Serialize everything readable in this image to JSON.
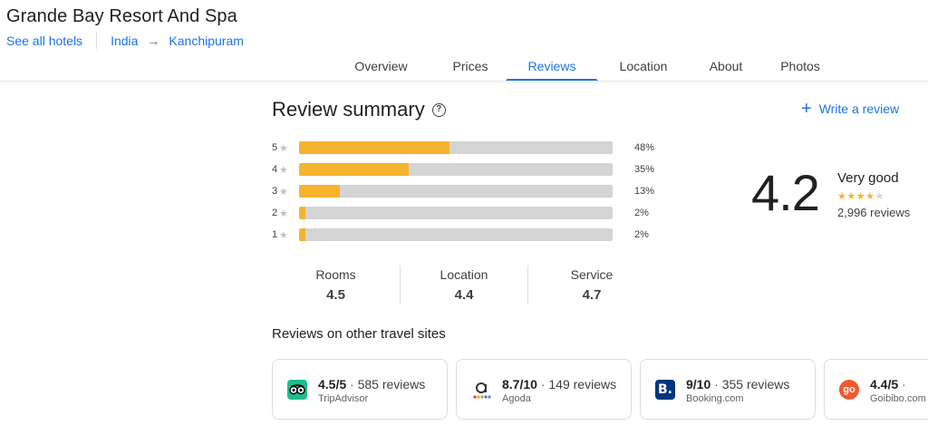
{
  "header": {
    "hotel_name": "Grande Bay Resort And Spa",
    "see_all": "See all hotels",
    "crumb_country": "India",
    "crumb_arrow": "→",
    "crumb_city": "Kanchipuram"
  },
  "tabs": [
    {
      "label": "Overview",
      "active": false
    },
    {
      "label": "Prices",
      "active": false
    },
    {
      "label": "Reviews",
      "active": true
    },
    {
      "label": "Location",
      "active": false
    },
    {
      "label": "About",
      "active": false
    },
    {
      "label": "Photos",
      "active": false
    }
  ],
  "summary": {
    "title": "Review summary",
    "help_glyph": "?",
    "write_review": "Write a review",
    "write_plus": "+"
  },
  "distribution": [
    {
      "stars": "5",
      "percent": 48,
      "label": "48%"
    },
    {
      "stars": "4",
      "percent": 35,
      "label": "35%"
    },
    {
      "stars": "3",
      "percent": 13,
      "label": "13%"
    },
    {
      "stars": "2",
      "percent": 2,
      "label": "2%"
    },
    {
      "stars": "1",
      "percent": 2,
      "label": "2%"
    }
  ],
  "overall": {
    "score": "4.2",
    "label": "Very good",
    "stars_filled": 4,
    "stars_total": 5,
    "count": "2,996 reviews"
  },
  "categories": [
    {
      "name": "Rooms",
      "value": "4.5"
    },
    {
      "name": "Location",
      "value": "4.4"
    },
    {
      "name": "Service",
      "value": "4.7"
    }
  ],
  "other_sites": {
    "title": "Reviews on other travel sites",
    "sites": [
      {
        "score": "4.5/5",
        "reviews": "585 reviews",
        "name": "TripAdvisor",
        "icon": "tripadvisor-owl-icon"
      },
      {
        "score": "8.7/10",
        "reviews": "149 reviews",
        "name": "Agoda",
        "icon": "agoda-icon"
      },
      {
        "score": "9/10",
        "reviews": "355 reviews",
        "name": "Booking.com",
        "icon": "booking-b-icon"
      },
      {
        "score": "4.4/5",
        "reviews": "",
        "name": "Goibibo.com",
        "icon": "goibibo-go-icon"
      }
    ]
  },
  "colors": {
    "accent": "#1a73e8",
    "bar_fill": "#f5b32e",
    "bar_track": "#d4d4d4"
  }
}
